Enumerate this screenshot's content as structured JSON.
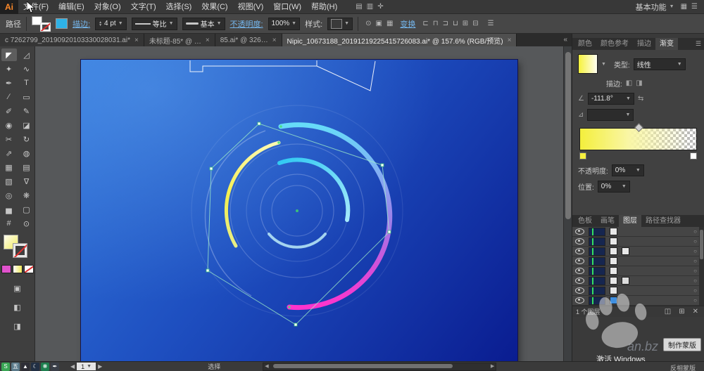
{
  "app": {
    "logo": "Ai"
  },
  "menu_bar": {
    "items": [
      "文件(F)",
      "编辑(E)",
      "对象(O)",
      "文字(T)",
      "选择(S)",
      "效果(C)",
      "视图(V)",
      "窗口(W)",
      "帮助(H)"
    ],
    "mid_icons": [
      "▤",
      "▥",
      "✛"
    ],
    "workspace_label": "基本功能",
    "right_icons": [
      "▦",
      "☰"
    ]
  },
  "control_bar": {
    "context_label": "路径",
    "stroke_link": "描边:",
    "stroke_weight": "4 pt",
    "profile_value": "等比",
    "brush_value": "基本",
    "opacity_link": "不透明度:",
    "opacity_value": "100%",
    "style_label": "样式:",
    "doc_icons": [
      "⊙",
      "▣",
      "▦"
    ],
    "transform_link": "变换",
    "align_icons": [
      "⊏",
      "⊓",
      "⊐",
      "⊔",
      "⊞",
      "⊟"
    ],
    "menu_icon": "☰"
  },
  "document_tabs": {
    "tabs": [
      {
        "label": "c 7262799_20190920103330028031.ai*",
        "close": "×",
        "active": false
      },
      {
        "label": "未标题-85* @ …",
        "close": "×",
        "active": false
      },
      {
        "label": "85.ai* @ 326…",
        "close": "×",
        "active": false
      },
      {
        "label": "Nipic_10673188_20191219225415726083.ai* @ 157.6% (RGB/预览)",
        "close": "×",
        "active": true
      }
    ]
  },
  "toolbar": {
    "tools": [
      {
        "glyph": "◤",
        "name": "selection-tool"
      },
      {
        "glyph": "◿",
        "name": "direct-selection-tool"
      },
      {
        "glyph": "✦",
        "name": "magic-wand-tool"
      },
      {
        "glyph": "∿",
        "name": "lasso-tool"
      },
      {
        "glyph": "✒",
        "name": "pen-tool"
      },
      {
        "glyph": "T",
        "name": "type-tool"
      },
      {
        "glyph": "∕",
        "name": "line-segment-tool"
      },
      {
        "glyph": "▭",
        "name": "rectangle-tool"
      },
      {
        "glyph": "✐",
        "name": "paintbrush-tool"
      },
      {
        "glyph": "✎",
        "name": "pencil-tool"
      },
      {
        "glyph": "◉",
        "name": "blob-brush-tool"
      },
      {
        "glyph": "◪",
        "name": "eraser-tool"
      },
      {
        "glyph": "✂",
        "name": "scissors-tool"
      },
      {
        "glyph": "↻",
        "name": "rotate-tool"
      },
      {
        "glyph": "⇗",
        "name": "scale-tool"
      },
      {
        "glyph": "◍",
        "name": "shape-builder-tool"
      },
      {
        "glyph": "▦",
        "name": "perspective-grid-tool"
      },
      {
        "glyph": "▤",
        "name": "mesh-tool"
      },
      {
        "glyph": "▧",
        "name": "gradient-tool"
      },
      {
        "glyph": "∇",
        "name": "eyedropper-tool"
      },
      {
        "glyph": "◎",
        "name": "blend-tool"
      },
      {
        "glyph": "❋",
        "name": "symbol-sprayer-tool"
      },
      {
        "glyph": "▅",
        "name": "column-graph-tool"
      },
      {
        "glyph": "▢",
        "name": "artboard-tool"
      },
      {
        "glyph": "#",
        "name": "slice-tool"
      },
      {
        "glyph": "⊙",
        "name": "zoom-tool"
      }
    ],
    "bottom_icons": [
      "▣",
      "◧",
      "◨"
    ]
  },
  "canvas": {
    "artboard_top": "#3277dc",
    "artboard_mid": "#1e4fc0",
    "artboard_bottom": "#0a1c90",
    "ring_gradient": [
      "#66dcf8",
      "#86a8f2",
      "#a07ae8",
      "#d44fd8",
      "#ff33cc"
    ],
    "yellow_gradient": [
      "#fdf9b0",
      "#f4ef4f",
      "#e7ed86"
    ],
    "cyan_gradient": [
      "#2fc9f2",
      "#a5e9fb"
    ]
  },
  "panels": {
    "color_tabs": [
      "颜色",
      "颜色参考",
      "描边",
      "渐变"
    ],
    "gradient": {
      "type_label": "类型:",
      "type_value": "线性",
      "stroke_label": "描边:",
      "angle_value": "-111.8°",
      "aspect_value": "",
      "opacity_label": "不透明度:",
      "opacity_value": "0%",
      "position_label": "位置:",
      "position_value": "0%",
      "stops": {
        "left_color": "#f6ef3e",
        "right_color": "#ffffff"
      }
    },
    "panel_tabs": [
      "色板",
      "画笔",
      "图层",
      "路径查找器"
    ],
    "layers": {
      "rows": [
        {
          "chips": [
            "#e8e8e8"
          ]
        },
        {
          "chips": [
            "#e8e8e8"
          ]
        },
        {
          "chips": [
            "#e8e8e8",
            "#e8e8e8"
          ]
        },
        {
          "chips": [
            "#e8e8e8"
          ]
        },
        {
          "chips": [
            "#e8e8e8"
          ]
        },
        {
          "chips": [
            "#e8e8e8",
            "#dcdcdc"
          ]
        },
        {
          "chips": [
            "#e8e8e8"
          ]
        },
        {
          "chips": [
            "#3f8fe0"
          ]
        }
      ],
      "footer_count": "1 个图层",
      "footer_icons": [
        "◫",
        "⊞",
        "✕"
      ]
    },
    "make_mask_button": "制作蒙版",
    "invert_mask_label": "反相蒙版"
  },
  "status_bar": {
    "artboard_value": "1",
    "status_text": "选择",
    "taskbar_icons": [
      {
        "glyph": "S",
        "bg": "#3aa655"
      },
      {
        "glyph": "五",
        "bg": "#5a7a8a"
      },
      {
        "glyph": "▲",
        "bg": "#2e2e36"
      },
      {
        "glyph": "☾",
        "bg": "#223044"
      },
      {
        "glyph": "❋",
        "bg": "#1f8050"
      },
      {
        "glyph": "✒",
        "bg": "#3a3f48"
      }
    ]
  },
  "watermark": {
    "activate_text": "激活 Windows",
    "site_text": "an.bz"
  }
}
